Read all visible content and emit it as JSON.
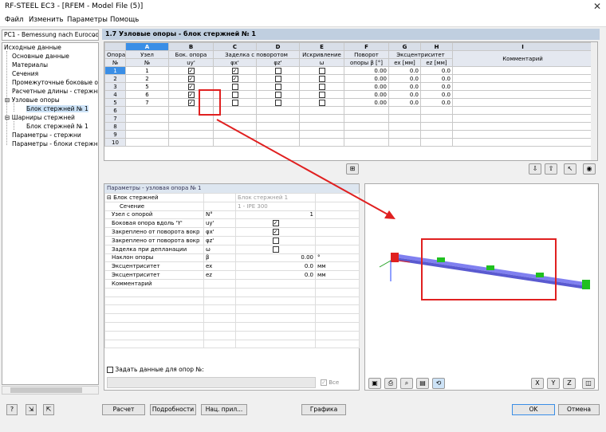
{
  "window": {
    "title": "RF-STEEL EC3 - [RFEM - Model File (5)]"
  },
  "menu": [
    "Файл",
    "Изменить",
    "Параметры",
    "Помощь"
  ],
  "case_select": "РС1 - Bemessung nach Eurocod",
  "tree": {
    "root": "Исходные данные",
    "items": [
      "Основные данные",
      "Материалы",
      "Сечения",
      "Промежуточные боковые опо",
      "Расчетные длины - стержни",
      "Узловые опоры",
      "Блок стержней № 1",
      "Шарниры стержней",
      "Блок стержней № 1",
      "Параметры - стержни",
      "Параметры - блоки стержней"
    ]
  },
  "panel_title": "1.7 Узловые опоры - блок стержней № 1",
  "grid": {
    "letters": [
      "A",
      "B",
      "C",
      "D",
      "E",
      "F",
      "G",
      "H",
      "I"
    ],
    "hdr_top": [
      "Опора",
      "Узел",
      "Бок. опора",
      "Заделка с поворотом",
      "Искривление",
      "Поворот",
      "Эксцентриситет",
      "Комментарий"
    ],
    "hdr_sub": [
      "№",
      "№",
      "uy'",
      "φx'",
      "φz'",
      "ω",
      "опоры β [°]",
      "ex [мм]",
      "ez [мм]"
    ],
    "rows": [
      {
        "n": "1",
        "node": "1",
        "beta": "0.00",
        "ex": "0.0",
        "ez": "0.0"
      },
      {
        "n": "2",
        "node": "2",
        "beta": "0.00",
        "ex": "0.0",
        "ez": "0.0"
      },
      {
        "n": "3",
        "node": "5",
        "beta": "0.00",
        "ex": "0.0",
        "ez": "0.0"
      },
      {
        "n": "4",
        "node": "6",
        "beta": "0.00",
        "ex": "0.0",
        "ez": "0.0"
      },
      {
        "n": "5",
        "node": "7",
        "beta": "0.00",
        "ex": "0.0",
        "ez": "0.0"
      },
      {
        "n": "6"
      },
      {
        "n": "7"
      },
      {
        "n": "8"
      },
      {
        "n": "9"
      },
      {
        "n": "10"
      }
    ]
  },
  "params": {
    "title": "Параметры - узловая опора № 1",
    "rows": [
      {
        "label": "Блок стержней",
        "sym": "",
        "val": "Блок стержней 1",
        "unit": ""
      },
      {
        "label": "Сечение",
        "sym": "",
        "val": "1 - IPE 300",
        "unit": ""
      },
      {
        "label": "Узел с опорой",
        "sym": "N°",
        "val": "1",
        "unit": ""
      },
      {
        "label": "Боковая опора вдоль 'Y'",
        "sym": "uy'",
        "val": "",
        "unit": ""
      },
      {
        "label": "Закреплено от поворота вокр",
        "sym": "φx'",
        "val": "",
        "unit": ""
      },
      {
        "label": "Закреплено от поворота вокр",
        "sym": "φz'",
        "val": "",
        "unit": ""
      },
      {
        "label": "Заделка при депланации",
        "sym": "ω",
        "val": "",
        "unit": ""
      },
      {
        "label": "Наклон опоры",
        "sym": "β",
        "val": "0.00",
        "unit": "°"
      },
      {
        "label": "Эксцентриситет",
        "sym": "ex",
        "val": "0.0",
        "unit": "мм"
      },
      {
        "label": "Эксцентриситет",
        "sym": "ez",
        "val": "0.0",
        "unit": "мм"
      },
      {
        "label": "Комментарий",
        "sym": "",
        "val": "",
        "unit": ""
      }
    ]
  },
  "set_supports_label": "Задать данные для опор №:",
  "all_label": "Все",
  "buttons": {
    "calc": "Расчет",
    "details": "Подробности",
    "nat": "Нац. прил...",
    "graphics": "Графика",
    "ok": "OK",
    "cancel": "Отмена"
  },
  "colors": {
    "accent": "#3a8ee6",
    "highlight": "#e02020",
    "member": "#6464e0",
    "support": "#20c020"
  }
}
